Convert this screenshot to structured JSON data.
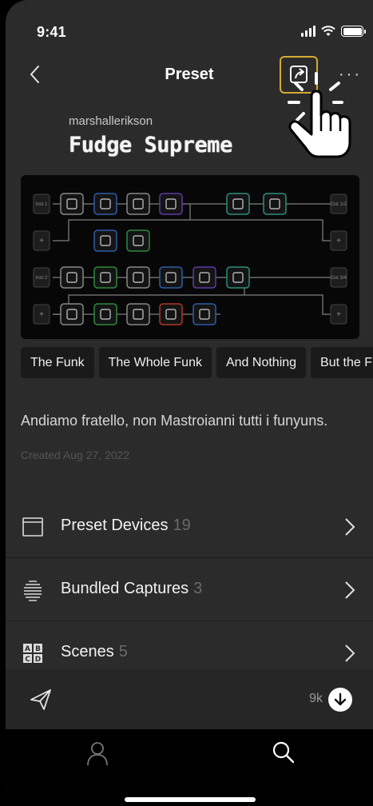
{
  "status": {
    "time": "9:41"
  },
  "nav": {
    "title": "Preset",
    "more": "···"
  },
  "preset": {
    "author": "marshallerikson",
    "name": "Fudge Supreme",
    "tags": [
      "The Funk",
      "The Whole Funk",
      "And Nothing",
      "But the F"
    ],
    "description": "Andiamo fratello, non Mastroianni tutti i funyuns.",
    "created": "Created Aug 27, 2022"
  },
  "sections": [
    {
      "label": "Preset Devices",
      "count": "19",
      "icon": "device-icon"
    },
    {
      "label": "Bundled Captures",
      "count": "3",
      "icon": "capture-icon"
    },
    {
      "label": "Scenes",
      "count": "5",
      "icon": "scenes-icon"
    }
  ],
  "actions": {
    "download_count": "9k"
  },
  "board": {
    "input_1": "Inst 1",
    "input_2": "Inst 2",
    "out_1": "Out 1/2",
    "out_2": "Out 3/4"
  },
  "colors": {
    "accent": "#d7a930",
    "blue": "#2e5da8",
    "green": "#2e8a3c",
    "purple": "#5e3aa8",
    "teal": "#2b8e7c",
    "red": "#b53527"
  }
}
